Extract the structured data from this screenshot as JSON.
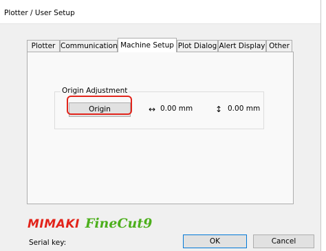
{
  "window": {
    "title": "Plotter / User Setup"
  },
  "tabs": [
    {
      "label": "Plotter"
    },
    {
      "label": "Communication"
    },
    {
      "label": "Machine Setup",
      "active": true
    },
    {
      "label": "Plot Dialog"
    },
    {
      "label": "Alert Display"
    },
    {
      "label": "Other"
    }
  ],
  "origin_adjustment": {
    "group_label": "Origin Adjustment",
    "origin_button_label": "Origin",
    "x_arrow": "↔",
    "x_value": "0.00 mm",
    "y_arrow": "↕",
    "y_value": "0.00 mm"
  },
  "branding": {
    "brand": "Mimaki",
    "product": "FineCut9",
    "brand_color": "#e2231a",
    "product_color": "#4caf1c"
  },
  "footer": {
    "serial_label": "Serial key:",
    "ok_label": "OK",
    "cancel_label": "Cancel"
  },
  "highlight_color": "#e2231a"
}
